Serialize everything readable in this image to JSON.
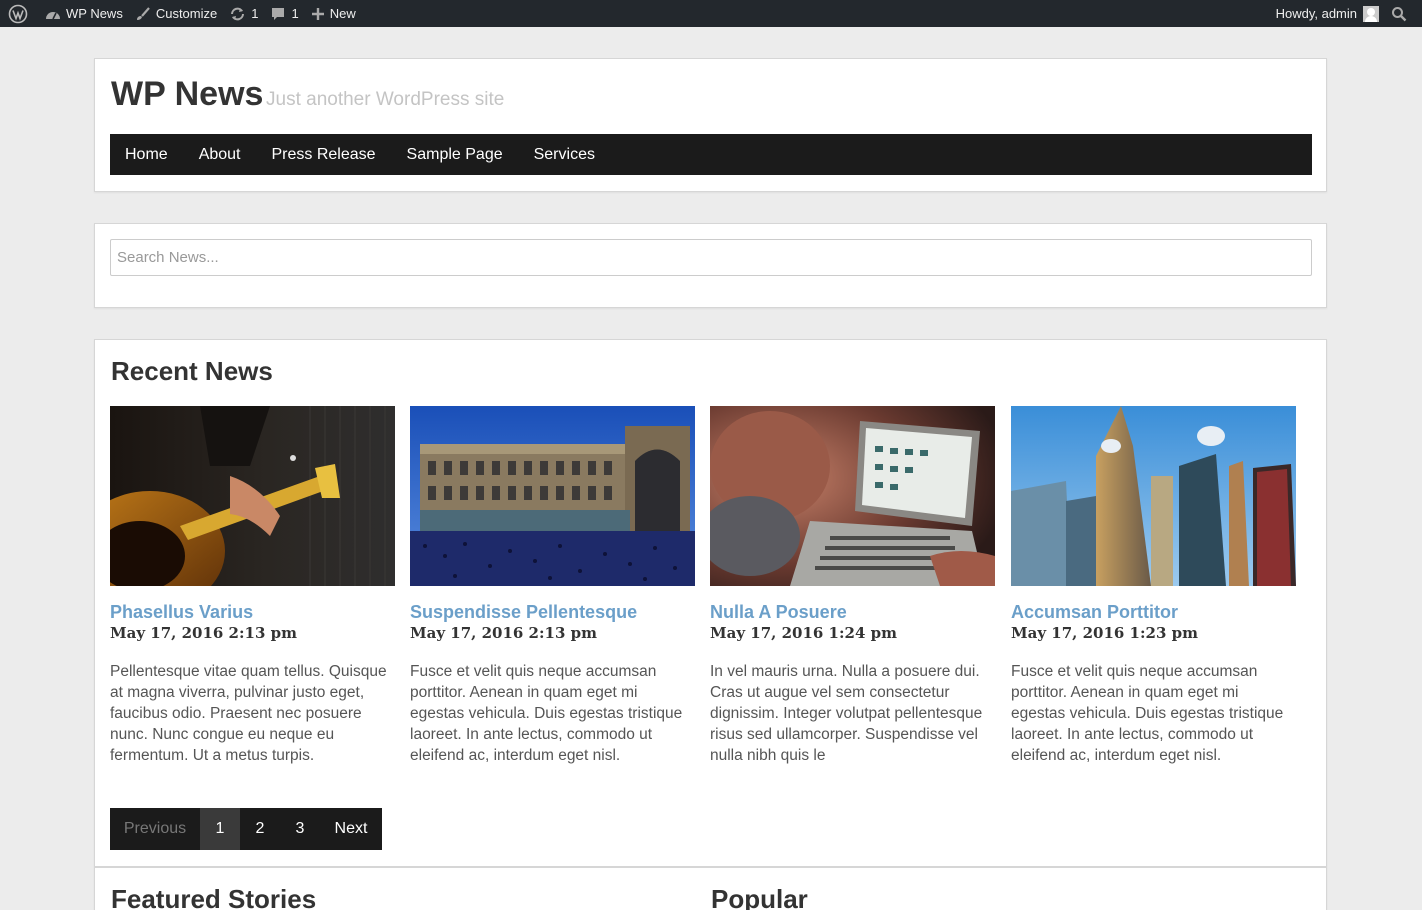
{
  "admin_bar": {
    "site_name": "WP News",
    "customize": "Customize",
    "updates_count": "1",
    "comments_count": "1",
    "new_label": "New",
    "greeting": "Howdy, admin"
  },
  "header": {
    "site_title": "WP News",
    "tagline": "Just another WordPress site"
  },
  "nav": {
    "items": [
      {
        "label": "Home"
      },
      {
        "label": "About"
      },
      {
        "label": "Press Release"
      },
      {
        "label": "Sample Page"
      },
      {
        "label": "Services"
      }
    ]
  },
  "search": {
    "placeholder": "Search News..."
  },
  "recent_news": {
    "title": "Recent News",
    "posts": [
      {
        "title": "Phasellus Varius",
        "date": "May 17, 2016 2:13 pm",
        "excerpt": "Pellentesque vitae quam tellus. Quisque at magna viverra, pulvinar justo eget, faucibus odio. Praesent nec posuere nunc. Nunc congue eu neque eu fermentum. Ut a metus turpis.",
        "image": "guitar-photo"
      },
      {
        "title": "Suspendisse Pellentesque",
        "date": "May 17, 2016 2:13 pm",
        "excerpt": "Fusce et velit quis neque accumsan porttitor. Aenean in quam eget mi egestas vehicula. Duis egestas tristique laoreet. In ante lectus, commodo ut eleifend ac, interdum eget nisl.",
        "image": "plaza-photo"
      },
      {
        "title": "Nulla A Posuere",
        "date": "May 17, 2016 1:24 pm",
        "excerpt": "In vel mauris urna. Nulla a posuere dui. Cras ut augue vel sem consectetur dignissim. Integer volutpat pellentesque risus sed ullamcorper. Suspendisse vel nulla nibh quis le",
        "image": "laptop-photo"
      },
      {
        "title": "Accumsan Porttitor",
        "date": "May 17, 2016 1:23 pm",
        "excerpt": "Fusce et velit quis neque accumsan porttitor. Aenean in quam eget mi egestas vehicula. Duis egestas tristique laoreet. In ante lectus, commodo ut eleifend ac, interdum eget nisl.",
        "image": "skyscrapers-photo"
      }
    ],
    "pagination": {
      "previous": "Previous",
      "pages": [
        "1",
        "2",
        "3"
      ],
      "current": "1",
      "next": "Next"
    }
  },
  "bottom": {
    "featured_title": "Featured Stories",
    "popular_title": "Popular"
  },
  "colors": {
    "post_title": "#6b9fc9",
    "nav_background": "#1b1b1b",
    "admin_bar": "#23282d"
  }
}
